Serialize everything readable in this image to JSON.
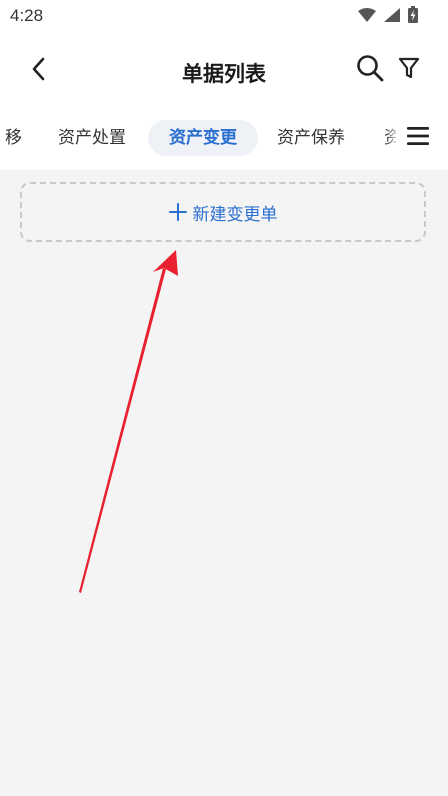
{
  "status_bar": {
    "time": "4:28",
    "icons": [
      "wifi-icon",
      "signal-icon",
      "battery-charging-icon"
    ]
  },
  "header": {
    "title": "单据列表",
    "back_icon": "chevron-left-icon",
    "search_icon": "search-icon",
    "filter_icon": "filter-icon"
  },
  "tabs": {
    "partial_left": "移",
    "items": [
      {
        "label": "资产处置",
        "active": false
      },
      {
        "label": "资产变更",
        "active": true
      },
      {
        "label": "资产保养",
        "active": false
      }
    ],
    "partial_right": "资",
    "menu_icon": "hamburger-menu-icon"
  },
  "main": {
    "new_button_label": "新建变更单",
    "new_button_icon": "plus-icon"
  },
  "colors": {
    "accent": "#2a6fd0",
    "active_tab_bg": "#eef1f6",
    "page_bg": "#f4f4f4",
    "annotation_arrow": "#e8202f"
  }
}
